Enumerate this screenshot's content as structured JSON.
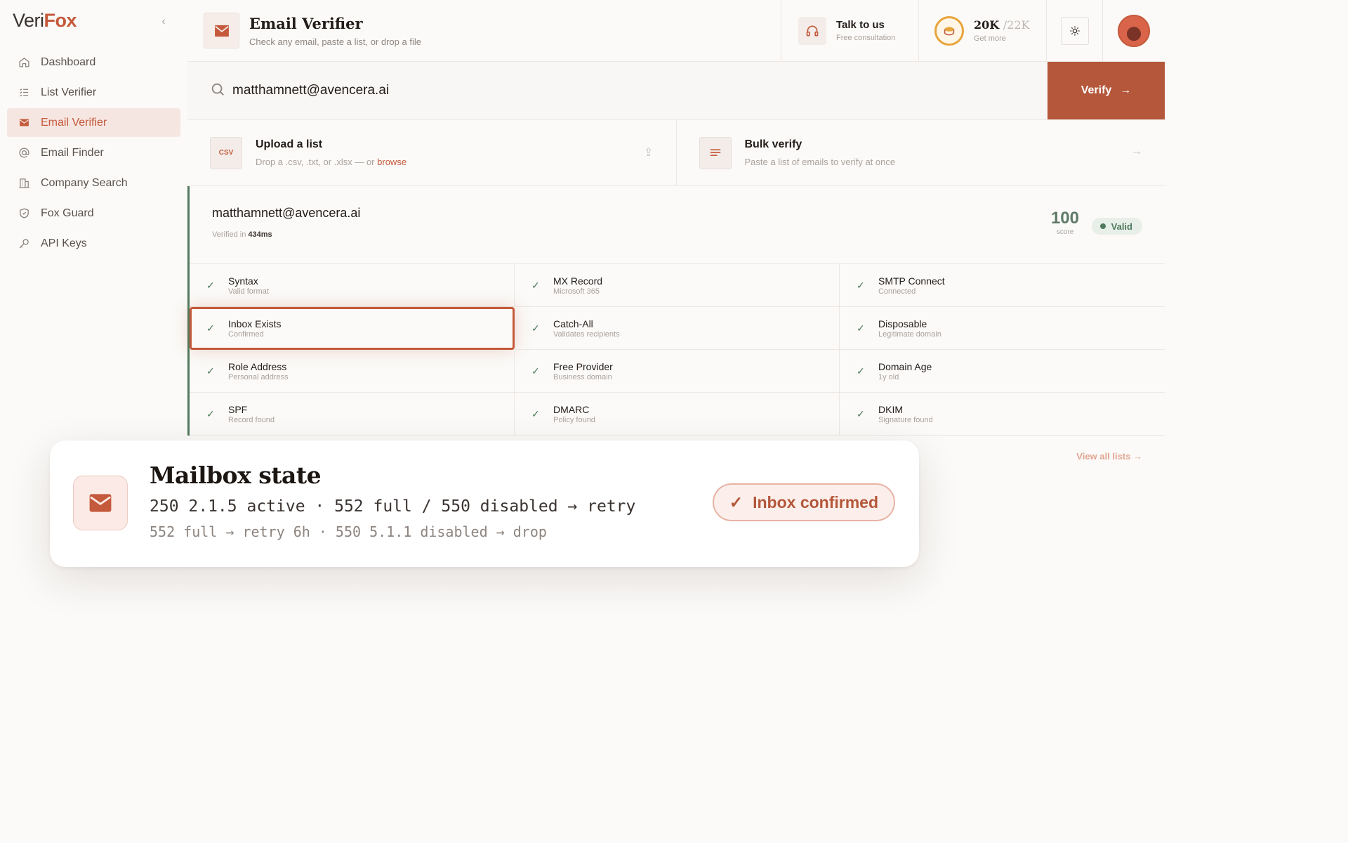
{
  "app": {
    "logo_veri": "Veri",
    "logo_fox": "Fox"
  },
  "sidebar": {
    "items": [
      {
        "label": "Dashboard",
        "icon": "home-icon"
      },
      {
        "label": "List Verifier",
        "icon": "list-icon"
      },
      {
        "label": "Email Verifier",
        "icon": "mail-icon",
        "active": true
      },
      {
        "label": "Email Finder",
        "icon": "at-icon"
      },
      {
        "label": "Company Search",
        "icon": "building-icon"
      },
      {
        "label": "Fox Guard",
        "icon": "shield-icon"
      },
      {
        "label": "API Keys",
        "icon": "key-icon"
      }
    ]
  },
  "header": {
    "title": "Email Verifier",
    "subtitle": "Check any email, paste a list, or drop a file",
    "talk_title": "Talk to us",
    "talk_sub": "Free consultation",
    "credits_used": "20K",
    "credits_total": "/22K",
    "credits_sub": "Get more"
  },
  "search": {
    "value": "matthamnett@avencera.ai",
    "verify_label": "Verify"
  },
  "upload": {
    "title": "Upload a list",
    "sub": "Drop a .csv, .txt, or .xlsx — or ",
    "browse": "browse",
    "csv_badge": "CSV"
  },
  "bulk": {
    "title": "Bulk verify",
    "sub": "Paste a list of emails to verify at once"
  },
  "result": {
    "email": "matthamnett@avencera.ai",
    "verified_prefix": "Verified in ",
    "verified_ms": "434ms",
    "score": "100",
    "score_label": "score",
    "status": "Valid",
    "status_color": "#4f7a5d"
  },
  "checks": [
    {
      "title": "Syntax",
      "sub": "Valid format"
    },
    {
      "title": "MX Record",
      "sub": "Microsoft 365"
    },
    {
      "title": "SMTP Connect",
      "sub": "Connected"
    },
    {
      "title": "Inbox Exists",
      "sub": "Confirmed"
    },
    {
      "title": "Catch-All",
      "sub": "Validates recipients"
    },
    {
      "title": "Disposable",
      "sub": "Legitimate domain"
    },
    {
      "title": "Role Address",
      "sub": "Personal address"
    },
    {
      "title": "Free Provider",
      "sub": "Business domain"
    },
    {
      "title": "Domain Age",
      "sub": "1y old"
    },
    {
      "title": "SPF",
      "sub": "Record found"
    },
    {
      "title": "DMARC",
      "sub": "Policy found"
    },
    {
      "title": "DKIM",
      "sub": "Signature found"
    }
  ],
  "lists": {
    "view_all": "View all lists"
  },
  "callout": {
    "title": "Mailbox state",
    "line1": "250 2.1.5 active · 552 full / 550 disabled → retry",
    "line2": "552 full → retry 6h · 550 5.1.1 disabled → drop",
    "badge": "Inbox confirmed"
  },
  "colors": {
    "accent": "#c4593b",
    "verify_bg": "#b4573a",
    "valid": "#4f7a5d"
  }
}
